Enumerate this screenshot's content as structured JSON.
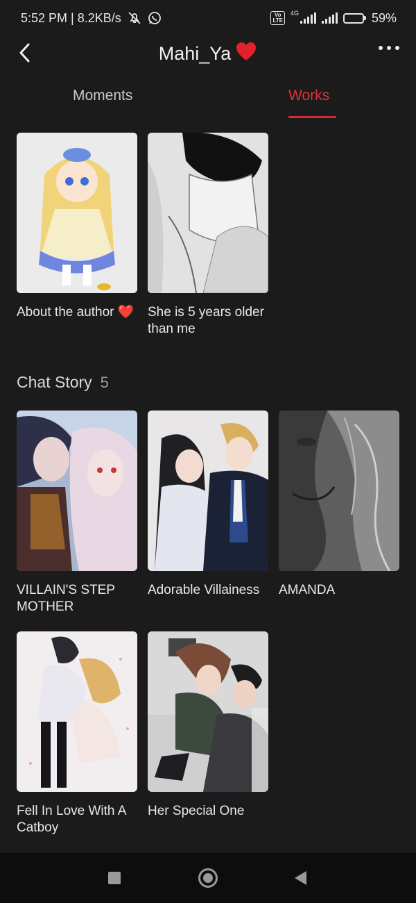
{
  "status_bar": {
    "time_speed": "5:52 PM | 8.2KB/s",
    "network_type": "4G",
    "volte": "Vo\nLTE",
    "battery": "59%",
    "battery_level": 0.59,
    "icons": [
      "mute-icon",
      "whatsapp-icon",
      "volte-icon",
      "signal-icon",
      "battery-icon"
    ]
  },
  "header": {
    "title": "Mahi_Ya",
    "back_icon": "chevron-left-icon",
    "more_icon": "more-dots-icon",
    "heart_color": "#e2202e"
  },
  "tabs": [
    {
      "label": "Moments",
      "active": false
    },
    {
      "label": "Works",
      "active": true
    }
  ],
  "accent_color": "#d52b37",
  "works": [
    {
      "title": "About  the author ❤️"
    },
    {
      "title": "She is 5 years older than me"
    }
  ],
  "chat_story": {
    "label": "Chat Story",
    "count": "5",
    "items": [
      {
        "title": "VILLAIN'S STEP MOTHER"
      },
      {
        "title": "Adorable Villainess"
      },
      {
        "title": "AMANDA"
      },
      {
        "title": "Fell In Love With A Catboy"
      },
      {
        "title": "Her Special One"
      }
    ]
  },
  "nav_bar": {
    "icons": [
      "recents-square-icon",
      "home-circle-icon",
      "back-triangle-icon"
    ]
  }
}
